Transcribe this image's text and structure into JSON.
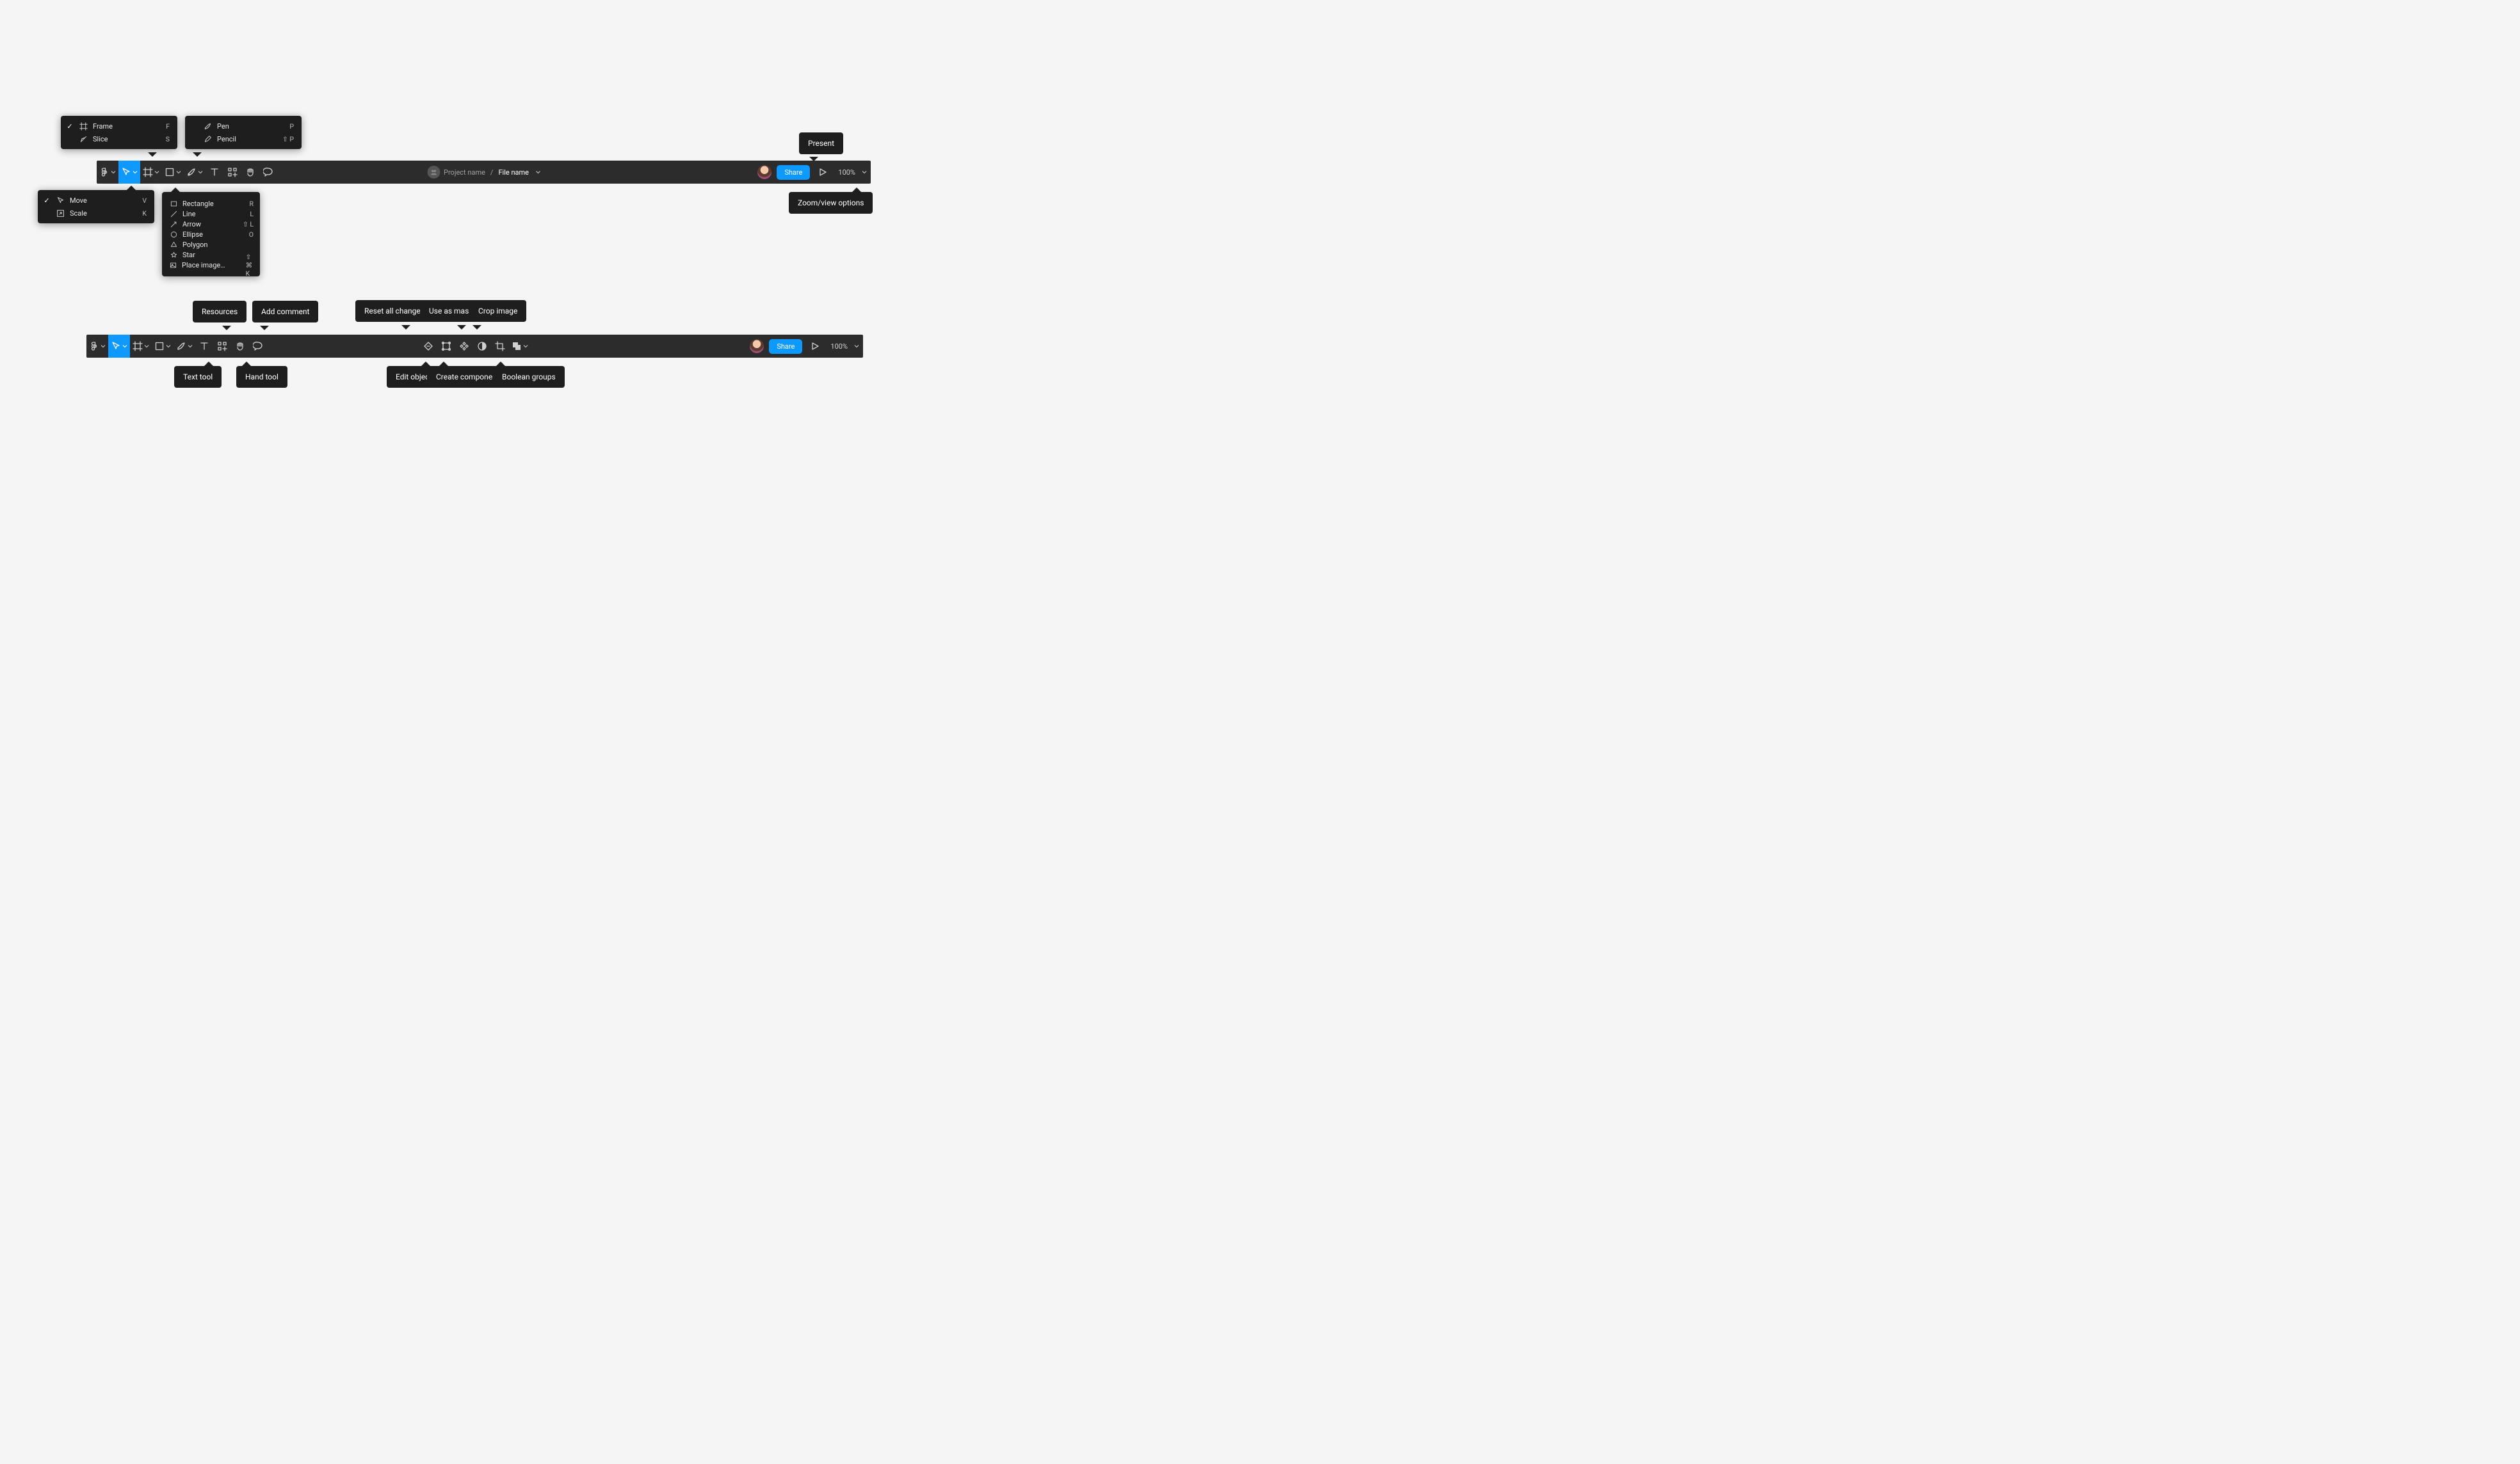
{
  "header": {
    "project_name": "Project name",
    "file_name": "File name",
    "share_label": "Share",
    "zoom": "100%"
  },
  "tooltips": {
    "present": "Present",
    "zoom": "Zoom/view options",
    "resources": "Resources",
    "add_comment": "Add comment",
    "text_tool": "Text tool",
    "hand_tool": "Hand tool",
    "reset_all": "Reset all changes",
    "use_as_mask": "Use as mask",
    "crop_image": "Crop image",
    "edit_object": "Edit object",
    "create_component": "Create component",
    "boolean_groups": "Boolean groups"
  },
  "menus": {
    "frame": [
      {
        "icon": "frame",
        "label": "Frame",
        "shortcut": "F",
        "checked": true
      },
      {
        "icon": "slice",
        "label": "Slice",
        "shortcut": "S",
        "checked": false
      }
    ],
    "move": [
      {
        "icon": "cursor",
        "label": "Move",
        "shortcut": "V",
        "checked": true
      },
      {
        "icon": "scale",
        "label": "Scale",
        "shortcut": "K",
        "checked": false
      }
    ],
    "pen": [
      {
        "icon": "pen",
        "label": "Pen",
        "shortcut": "P",
        "checked": false
      },
      {
        "icon": "pencil",
        "label": "Pencil",
        "shortcut": "⇧ P",
        "checked": false
      }
    ],
    "shape": [
      {
        "icon": "rect",
        "label": "Rectangle",
        "shortcut": "R"
      },
      {
        "icon": "line",
        "label": "Line",
        "shortcut": "L"
      },
      {
        "icon": "arrow",
        "label": "Arrow",
        "shortcut": "⇧ L"
      },
      {
        "icon": "ellipse",
        "label": "Ellipse",
        "shortcut": "O"
      },
      {
        "icon": "polygon",
        "label": "Polygon",
        "shortcut": ""
      },
      {
        "icon": "star",
        "label": "Star",
        "shortcut": ""
      },
      {
        "icon": "image",
        "label": "Place image…",
        "shortcut": "⇧ ⌘ K"
      }
    ]
  }
}
